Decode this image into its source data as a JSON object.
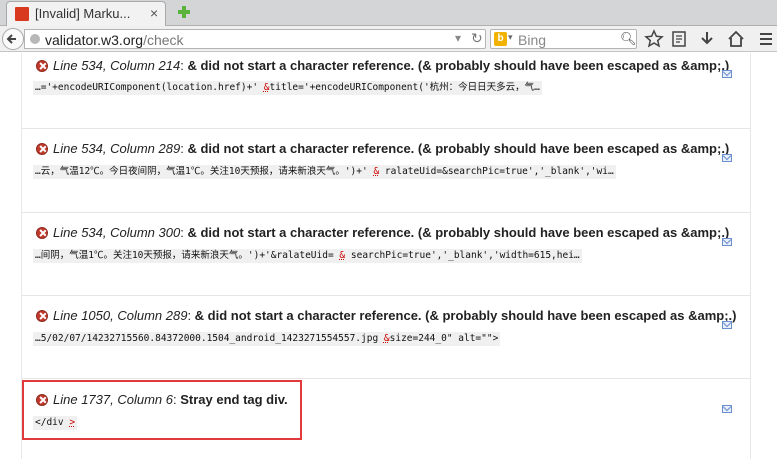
{
  "browser": {
    "tab_title": "[Invalid] Marku...",
    "tab_close": "×",
    "url_host": "validator.w3.org",
    "url_path": "/check",
    "search_placeholder": "Bing"
  },
  "messages": [
    {
      "location": "Line 534, Column 214",
      "message": "& did not start a character reference. (& probably should have been escaped as &amp;.)",
      "extract_before": "…='+encodeURIComponent(location.href)+'",
      "extract_mark": "&",
      "extract_after": "title='+encodeURIComponent('杭州：今日日天多云，气…"
    },
    {
      "location": "Line 534, Column 289",
      "message": "& did not start a character reference. (& probably should have been escaped as &amp;.)",
      "extract_before": "…云，气温12℃。今日夜间阴，气温1℃。关注10天预报，请来新浪天气。')+'",
      "extract_mark": "&",
      "extract_after": "ralateUid=&searchPic=true','_blank','wi…"
    },
    {
      "location": "Line 534, Column 300",
      "message": "& did not start a character reference. (& probably should have been escaped as &amp;.)",
      "extract_before": "…间阴，气温1℃。关注10天预报，请来新浪天气。')+'&ralateUid=",
      "extract_mark": "&",
      "extract_after": "searchPic=true','_blank','width=615,hei…"
    },
    {
      "location": "Line 1050, Column 289",
      "message": "& did not start a character reference. (& probably should have been escaped as &amp;.)",
      "extract_before": "…5/02/07/14232715560.84372000.1504_android_1423271554557.jpg",
      "extract_mark": "&",
      "extract_after": "size=244_0\" alt=\"\">"
    },
    {
      "location": "Line 1737, Column 6",
      "message": "Stray end tag div.",
      "extract_before": "</div",
      "extract_mark": ">",
      "extract_after": ""
    }
  ],
  "colors": {
    "error_red": "#c0392b",
    "highlight_border": "#e03a3a"
  }
}
